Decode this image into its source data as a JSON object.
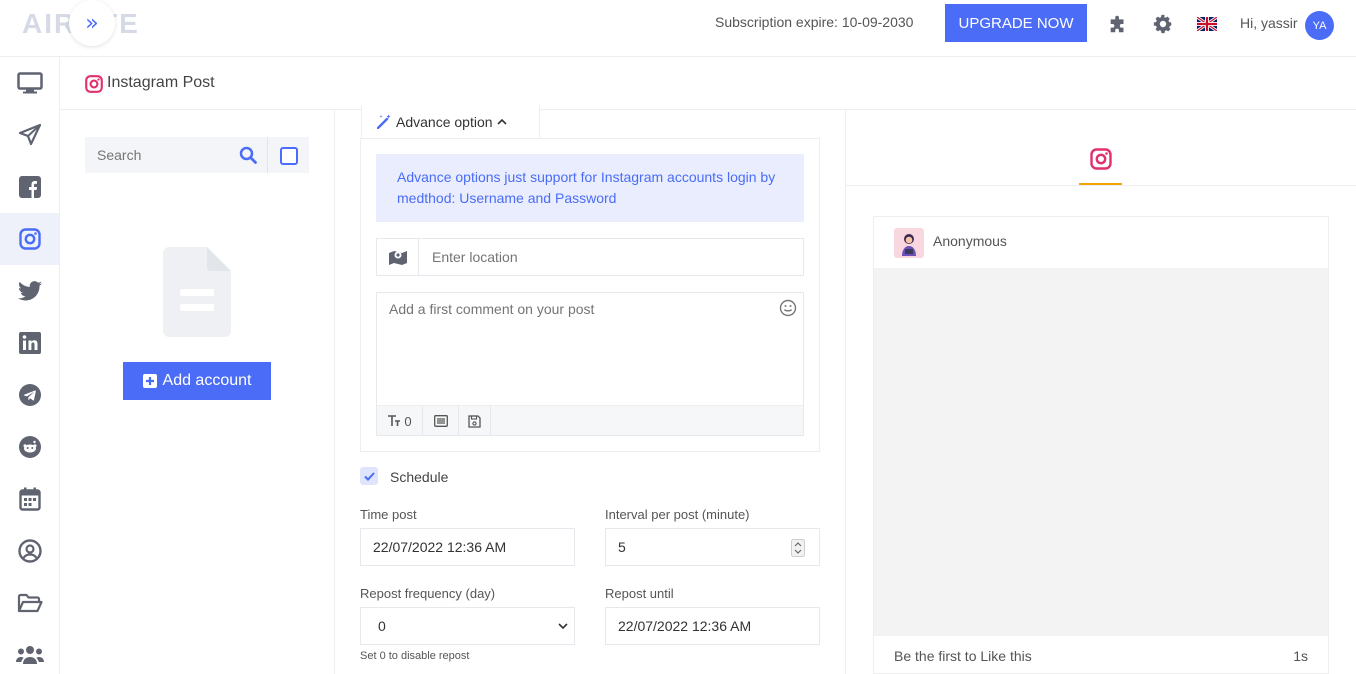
{
  "brand": {
    "logo_text": "AIROTE"
  },
  "topbar": {
    "subscription": "Subscription expire: 10-09-2030",
    "upgrade_label": "UPGRADE NOW",
    "greeting": "Hi, yassir",
    "avatar_initials": "YA"
  },
  "sidebar": {
    "items": [
      {
        "name": "dashboard",
        "icon": "monitor-icon"
      },
      {
        "name": "post",
        "icon": "paper-plane-icon"
      },
      {
        "name": "facebook",
        "icon": "facebook-icon"
      },
      {
        "name": "instagram",
        "icon": "instagram-icon",
        "active": true
      },
      {
        "name": "twitter",
        "icon": "twitter-icon"
      },
      {
        "name": "linkedin",
        "icon": "linkedin-icon"
      },
      {
        "name": "telegram",
        "icon": "telegram-icon"
      },
      {
        "name": "reddit",
        "icon": "reddit-icon"
      },
      {
        "name": "schedules",
        "icon": "calendar-icon"
      },
      {
        "name": "account",
        "icon": "user-circle-icon"
      },
      {
        "name": "file-manager",
        "icon": "folder-open-icon"
      },
      {
        "name": "team",
        "icon": "users-icon"
      }
    ]
  },
  "page": {
    "title": "Instagram Post"
  },
  "accounts": {
    "search_placeholder": "Search",
    "add_account_label": "Add account"
  },
  "advance": {
    "tab_label": "Advance option",
    "note": "Advance options just support for Instagram accounts login by medthod: Username and Password",
    "location_placeholder": "Enter location",
    "comment_placeholder": "Add a first comment on your post",
    "counter": "0"
  },
  "schedule": {
    "label": "Schedule",
    "checked": true,
    "time_post_label": "Time post",
    "time_post_value": "22/07/2022 12:36 AM",
    "interval_label": "Interval per post (minute)",
    "interval_value": "5",
    "repost_freq_label": "Repost frequency (day)",
    "repost_freq_value": "0",
    "repost_until_label": "Repost until",
    "repost_until_value": "22/07/2022 12:36 AM",
    "hint": "Set 0 to disable repost"
  },
  "preview": {
    "username": "Anonymous",
    "like_text": "Be the first to Like this",
    "time": "1s"
  },
  "colors": {
    "accent": "#4a6cf7",
    "instagram": "#e1306c",
    "tab_underline": "#f0a500",
    "icon_gray": "#5f6470"
  }
}
